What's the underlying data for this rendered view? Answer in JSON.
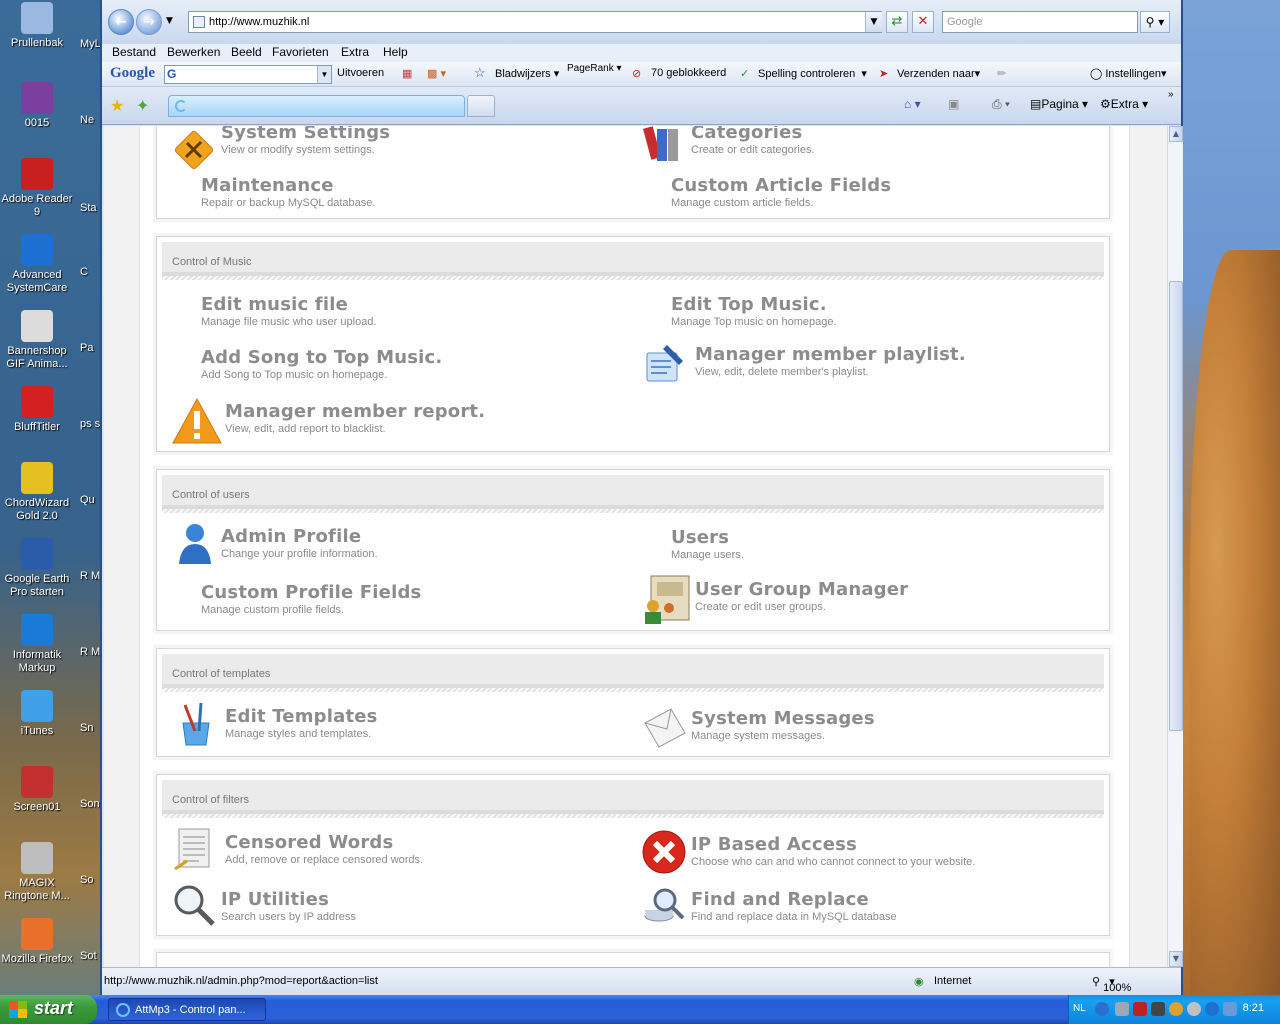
{
  "desktop": {
    "icons": [
      {
        "label": "Prullenbak",
        "color": "#9bb8e0"
      },
      {
        "label": "0015",
        "color": "#7b3fa0"
      },
      {
        "label": "Adobe Reader 9",
        "color": "#c8201e"
      },
      {
        "label": "Advanced SystemCare",
        "color": "#1d6fd1"
      },
      {
        "label": "Bannershop GIF Anima...",
        "color": "#dcdcdc"
      },
      {
        "label": "BluffTitler",
        "color": "#d42020"
      },
      {
        "label": "ChordWizard Gold 2.0",
        "color": "#e6c020"
      },
      {
        "label": "Google Earth Pro starten",
        "color": "#2a5caa"
      },
      {
        "label": "Informatik Markup",
        "color": "#1a7ad8"
      },
      {
        "label": "iTunes",
        "color": "#3fa0e8"
      },
      {
        "label": "Screen01",
        "color": "#c43030"
      },
      {
        "label": "MAGIX Ringtone M...",
        "color": "#bdbdbd"
      },
      {
        "label": "Mozilla Firefox",
        "color": "#e8702a"
      }
    ],
    "second_column": [
      "MyL",
      "Ne",
      "Sta",
      "C",
      "Pa",
      "ps seri",
      "Qu",
      "R M",
      "R Med",
      "Sn",
      "Son",
      "So",
      "Sot Vid"
    ]
  },
  "browser": {
    "url": "http://www.muzhik.nl",
    "search_placeholder": "Google",
    "menu": [
      "Bestand",
      "Bewerken",
      "Beeld",
      "Favorieten",
      "Extra",
      "Help"
    ],
    "google_toolbar": {
      "logo": "Google",
      "search_icon": "G",
      "run": "Uitvoeren",
      "bookmarks": "Bladwijzers",
      "pagerank": "PageRank",
      "blocked": "70 geblokkeerd",
      "spelling": "Spelling controleren",
      "send": "Verzenden naar",
      "settings": "Instellingen"
    },
    "command_bar": {
      "page": "Pagina",
      "extra": "Extra"
    },
    "status_url": "http://www.muzhik.nl/admin.php?mod=report&action=list",
    "zone": "Internet",
    "zoom": "100%"
  },
  "panels": {
    "top": {
      "items": [
        {
          "title": "System Settings",
          "desc": "View or modify system settings."
        },
        {
          "title": "Categories",
          "desc": "Create or edit categories."
        },
        {
          "title": "Maintenance",
          "desc": "Repair or backup MySQL database."
        },
        {
          "title": "Custom Article Fields",
          "desc": "Manage custom article fields."
        }
      ]
    },
    "music": {
      "heading": "Control of Music",
      "items": [
        {
          "title": "Edit music file",
          "desc": "Manage file music who user upload."
        },
        {
          "title": "Edit Top Music.",
          "desc": "Manage Top music on homepage."
        },
        {
          "title": "Add Song to Top Music.",
          "desc": "Add Song to Top music on homepage."
        },
        {
          "title": "Manager member playlist.",
          "desc": "View, edit, delete member's playlist."
        },
        {
          "title": "Manager member report.",
          "desc": "View, edit, add report to blacklist."
        }
      ]
    },
    "users": {
      "heading": "Control of users",
      "items": [
        {
          "title": "Admin Profile",
          "desc": "Change your profile information."
        },
        {
          "title": "Users",
          "desc": "Manage users."
        },
        {
          "title": "Custom Profile Fields",
          "desc": "Manage custom profile fields."
        },
        {
          "title": "User Group Manager",
          "desc": "Create or edit user groups."
        }
      ]
    },
    "templates": {
      "heading": "Control of templates",
      "items": [
        {
          "title": "Edit Templates",
          "desc": "Manage styles and templates."
        },
        {
          "title": "System Messages",
          "desc": "Manage system messages."
        }
      ]
    },
    "filters": {
      "heading": "Control of filters",
      "items": [
        {
          "title": "Censored Words",
          "desc": "Add, remove or replace censored words."
        },
        {
          "title": "IP Based Access",
          "desc": "Choose who can and who cannot connect to your website."
        },
        {
          "title": "IP Utilities",
          "desc": "Search users by IP address"
        },
        {
          "title": "Find and Replace",
          "desc": "Find and replace data in MySQL database"
        }
      ]
    }
  },
  "taskbar": {
    "start": "start",
    "task": "AttMp3 - Control pan...",
    "lang": "NL",
    "time": "8:21"
  }
}
